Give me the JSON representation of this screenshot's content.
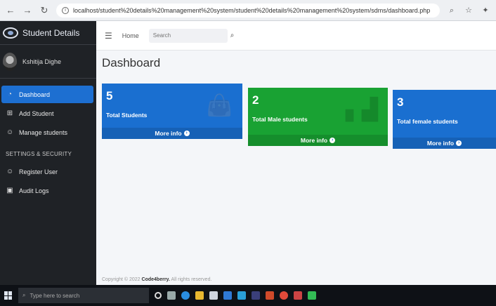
{
  "browser": {
    "url": "localhost/student%20details%20management%20system/student%20details%20management%20system/sdms/dashboard.php"
  },
  "sidebar": {
    "brand": "Student Details",
    "user_name": "Kshitija Dighe",
    "items": [
      {
        "label": "Dashboard",
        "icon": "dashboard-icon"
      },
      {
        "label": "Add Student",
        "icon": "plus-square-icon"
      },
      {
        "label": "Manage students",
        "icon": "user-icon"
      }
    ],
    "section_header": "SETTINGS & SECURITY",
    "settings_items": [
      {
        "label": "Register User",
        "icon": "user-icon"
      },
      {
        "label": "Audit Logs",
        "icon": "image-icon"
      }
    ]
  },
  "topnav": {
    "home": "Home",
    "search_placeholder": "Search"
  },
  "main": {
    "title": "Dashboard",
    "boxes": [
      {
        "number": "5",
        "label": "Total Students",
        "more": "More info",
        "color": "#1a6fd0"
      },
      {
        "number": "2",
        "label": "Total Male students",
        "more": "More info",
        "color": "#19a233"
      },
      {
        "number": "3",
        "label": "Total female students",
        "more": "More info",
        "color": "#1a6fd0"
      }
    ],
    "footer_prefix": "Copyright © 2022",
    "footer_brand": "Code4berry.",
    "footer_suffix": "All rights reserved."
  },
  "taskbar": {
    "search_placeholder": "Type here to search"
  }
}
